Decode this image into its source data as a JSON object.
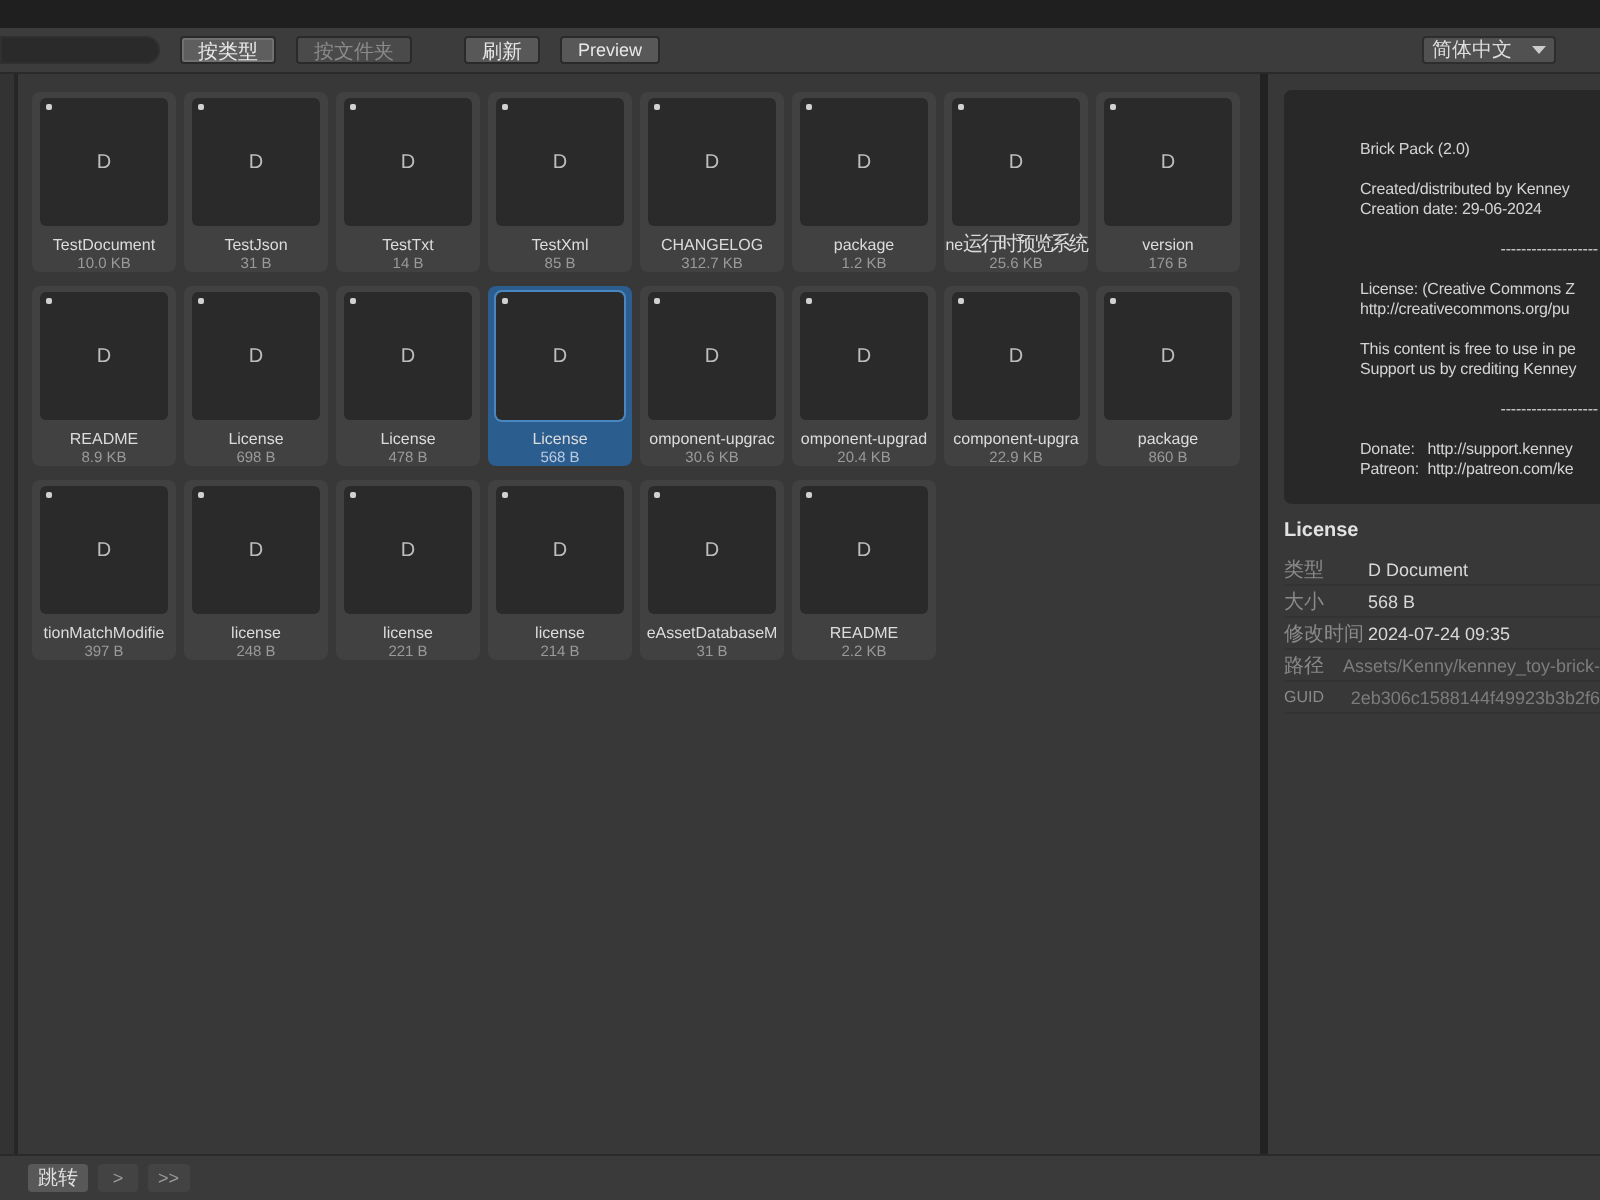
{
  "toolbar": {
    "buttons": [
      {
        "label": "按类型",
        "selected": true,
        "disabled": false
      },
      {
        "label": "按文件夹",
        "selected": false,
        "disabled": true
      },
      {
        "label": "刷新",
        "selected": false,
        "disabled": false
      },
      {
        "label": "Preview",
        "selected": false,
        "disabled": false
      }
    ],
    "language": "简体中文"
  },
  "files": [
    {
      "glyph": "D",
      "name": "TestDocument",
      "size": "10.0 KB",
      "selected": false
    },
    {
      "glyph": "D",
      "name": "TestJson",
      "size": "31 B",
      "selected": false
    },
    {
      "glyph": "D",
      "name": "TestTxt",
      "size": "14 B",
      "selected": false
    },
    {
      "glyph": "D",
      "name": "TestXml",
      "size": "85 B",
      "selected": false
    },
    {
      "glyph": "D",
      "name": "CHANGELOG",
      "size": "312.7 KB",
      "selected": false
    },
    {
      "glyph": "D",
      "name": "package",
      "size": "1.2 KB",
      "selected": false
    },
    {
      "glyph": "D",
      "name": "ne运行时预览系统",
      "size": "25.6 KB",
      "selected": false
    },
    {
      "glyph": "D",
      "name": "version",
      "size": "176 B",
      "selected": false
    },
    {
      "glyph": "D",
      "name": "README",
      "size": "8.9 KB",
      "selected": false
    },
    {
      "glyph": "D",
      "name": "License",
      "size": "698 B",
      "selected": false
    },
    {
      "glyph": "D",
      "name": "License",
      "size": "478 B",
      "selected": false
    },
    {
      "glyph": "D",
      "name": "License",
      "size": "568 B",
      "selected": true
    },
    {
      "glyph": "D",
      "name": "omponent-upgrac",
      "size": "30.6 KB",
      "selected": false
    },
    {
      "glyph": "D",
      "name": "omponent-upgrad",
      "size": "20.4 KB",
      "selected": false
    },
    {
      "glyph": "D",
      "name": "component-upgra",
      "size": "22.9 KB",
      "selected": false
    },
    {
      "glyph": "D",
      "name": "package",
      "size": "860 B",
      "selected": false
    },
    {
      "glyph": "D",
      "name": "tionMatchModifie",
      "size": "397 B",
      "selected": false
    },
    {
      "glyph": "D",
      "name": "license",
      "size": "248 B",
      "selected": false
    },
    {
      "glyph": "D",
      "name": "license",
      "size": "221 B",
      "selected": false
    },
    {
      "glyph": "D",
      "name": "license",
      "size": "214 B",
      "selected": false
    },
    {
      "glyph": "D",
      "name": "eAssetDatabaseM",
      "size": "31 B",
      "selected": false
    },
    {
      "glyph": "D",
      "name": "README",
      "size": "2.2 KB",
      "selected": false
    }
  ],
  "preview": {
    "paragraphs": [
      {
        "kind": "text",
        "lines": [
          "Brick Pack (2.0)"
        ]
      },
      {
        "kind": "text",
        "lines": [
          "Created/distributed by Kenney",
          "Creation date: 29-06-2024"
        ]
      },
      {
        "kind": "separator",
        "lines": [
          "-------------------"
        ]
      },
      {
        "kind": "text",
        "lines": [
          "License: (Creative Commons Z",
          "http://creativecommons.org/pu"
        ]
      },
      {
        "kind": "text",
        "lines": [
          "This content is free to use in pe",
          "Support us by crediting Kenney"
        ]
      },
      {
        "kind": "separator",
        "lines": [
          "-------------------"
        ]
      },
      {
        "kind": "text",
        "lines": [
          "Donate:   http://support.kenney",
          "Patreon:  http://patreon.com/ke"
        ]
      }
    ]
  },
  "details": {
    "title": "License",
    "rows": [
      {
        "label": "类型",
        "value": "D  Document",
        "disabled": false
      },
      {
        "label": "大小",
        "value": "568 B",
        "disabled": false
      },
      {
        "label": "修改时间",
        "value": "2024-07-24 09:35",
        "disabled": false
      },
      {
        "label": "路径",
        "value": "Assets/Kenny/kenney_toy-brick-",
        "disabled": true
      },
      {
        "label": "GUID",
        "value": "2eb306c1588144f49923b3b2f6",
        "disabled": true
      }
    ]
  },
  "footer": {
    "buttons": [
      {
        "label": "跳转",
        "disabled": false
      },
      {
        "label": ">",
        "disabled": true
      },
      {
        "label": ">>",
        "disabled": true
      }
    ]
  }
}
